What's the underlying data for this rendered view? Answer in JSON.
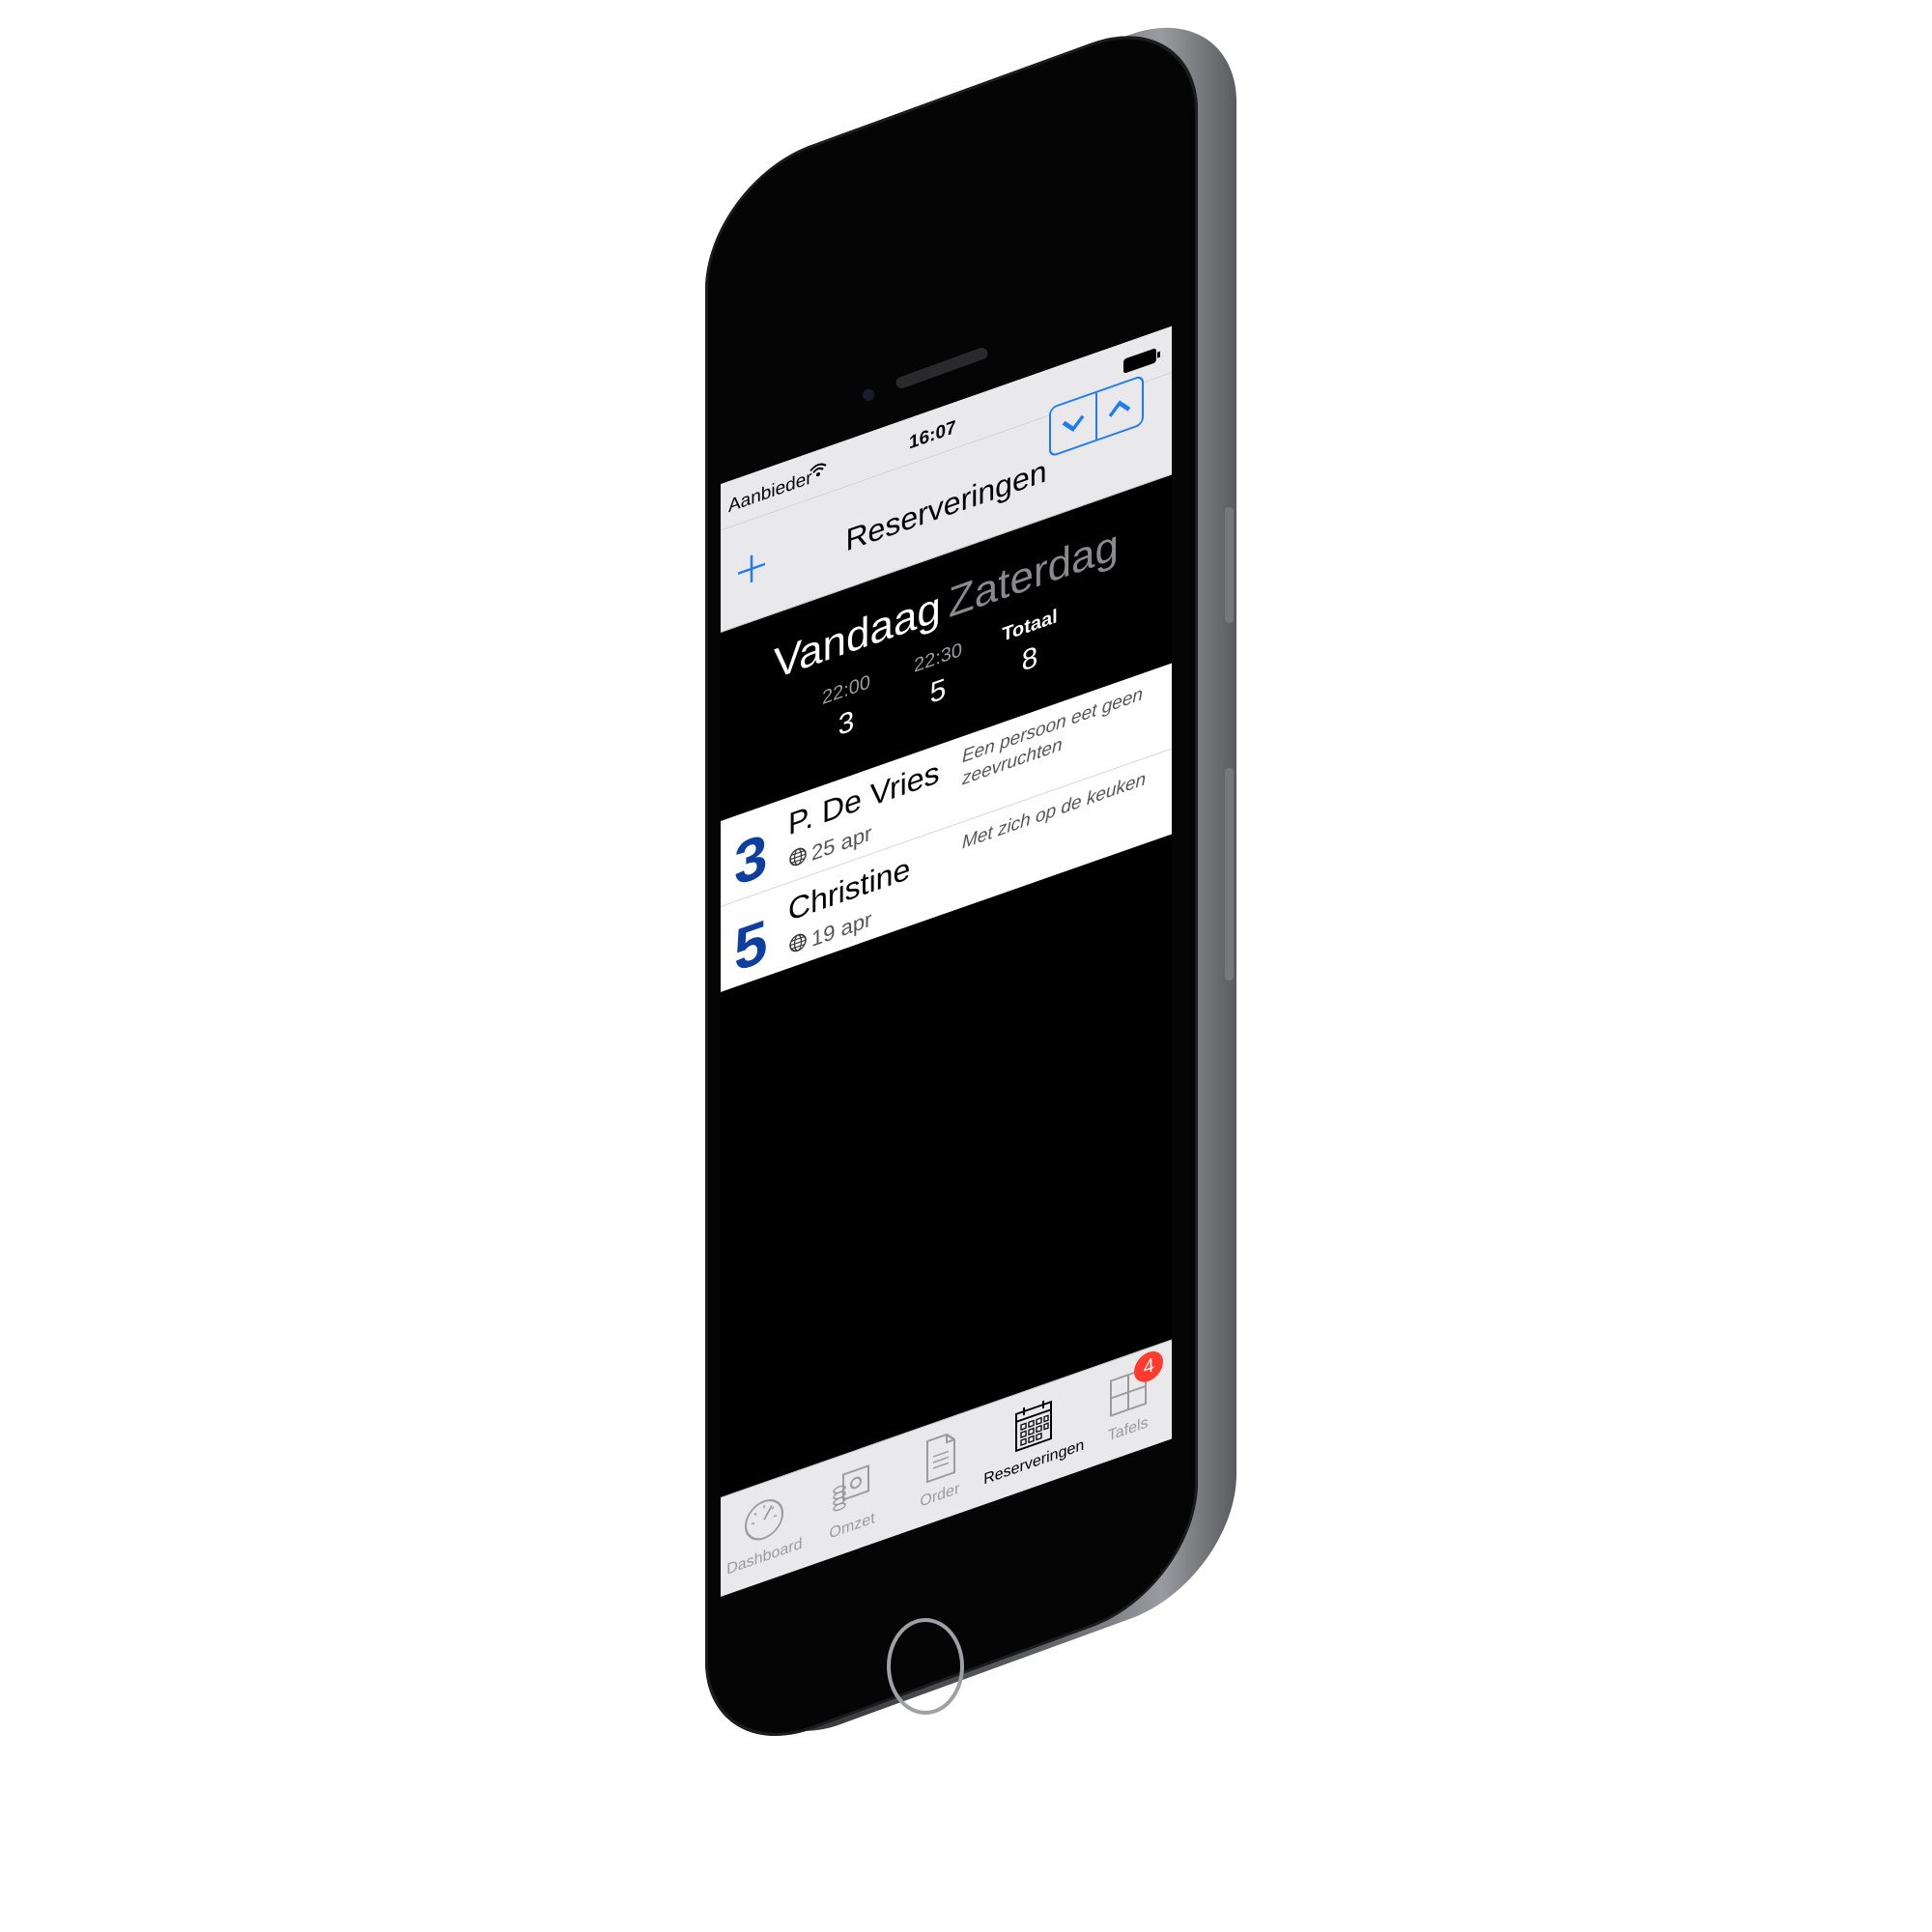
{
  "status_bar": {
    "carrier": "Aanbieder",
    "time": "16:07"
  },
  "nav": {
    "title": "Reserveringen",
    "add_icon": "plus-icon",
    "down_icon": "chevron-down-icon",
    "up_icon": "chevron-up-icon"
  },
  "day_header": {
    "today": "Vandaag",
    "weekday": "Zaterdag"
  },
  "stats": [
    {
      "label": "22:00",
      "value": "3"
    },
    {
      "label": "22:30",
      "value": "5"
    },
    {
      "label": "Totaal",
      "value": "8"
    }
  ],
  "reservations": [
    {
      "count": "3",
      "name": "P. De Vries",
      "date": "25 apr",
      "note": "Een persoon eet geen zeevruchten"
    },
    {
      "count": "5",
      "name": "Christine",
      "date": "19 apr",
      "note": "Met zich op de keuken"
    }
  ],
  "tabs": [
    {
      "label": "Dashboard",
      "icon": "gauge-icon"
    },
    {
      "label": "Omzet",
      "icon": "coins-icon"
    },
    {
      "label": "Order",
      "icon": "document-icon"
    },
    {
      "label": "Reserveringen",
      "icon": "calendar-icon"
    },
    {
      "label": "Tafels",
      "icon": "tables-icon",
      "badge": "4"
    }
  ],
  "colors": {
    "accent": "#1f7bf2",
    "count_blue": "#0e3ea0",
    "badge_red": "#ff3b30"
  }
}
